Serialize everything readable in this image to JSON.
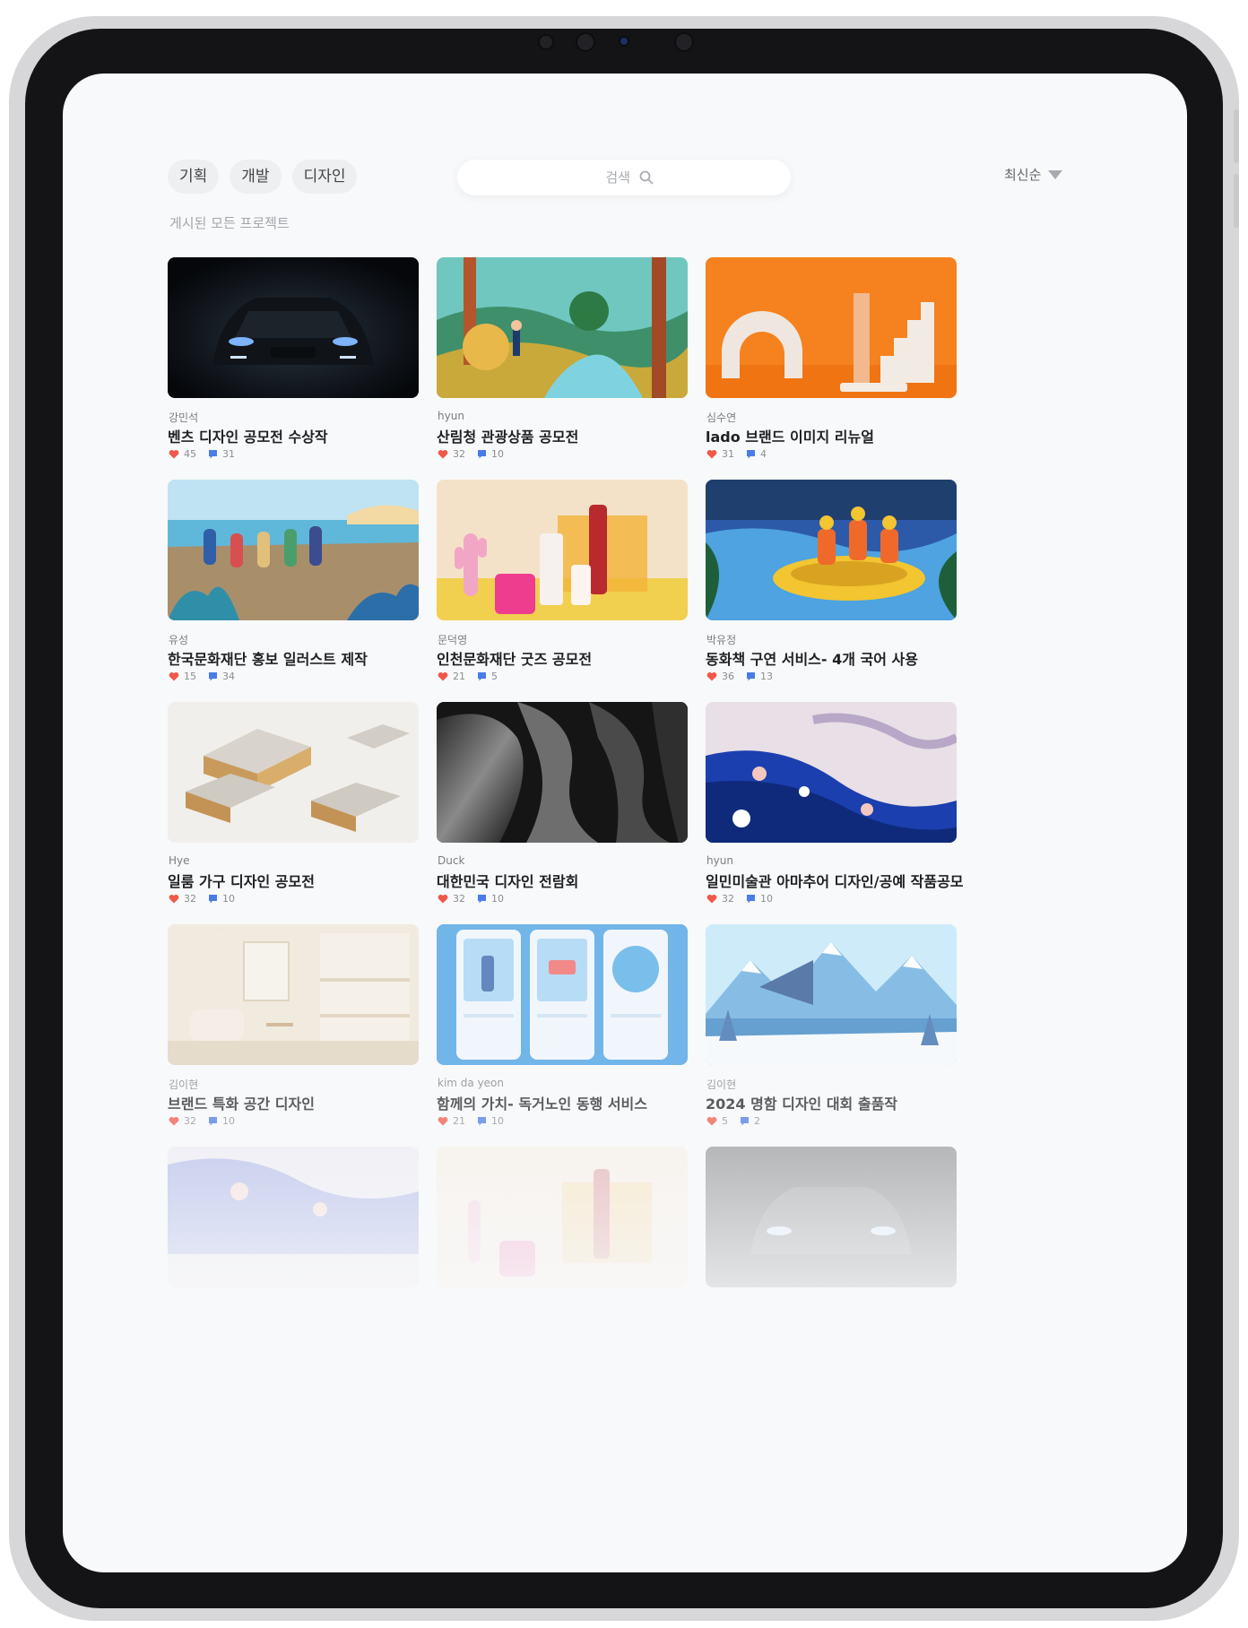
{
  "filters": [
    "기획",
    "개발",
    "디자인"
  ],
  "subtitle": "게시된 모든 프로젝트",
  "search": {
    "placeholder": "검색"
  },
  "sort": {
    "label": "최신순"
  },
  "projects": [
    {
      "author": "강민석",
      "title": "벤츠 디자인 공모전 수상작",
      "likes": "45",
      "comments": "31",
      "image": "dark car headlights"
    },
    {
      "author": "hyun",
      "title": "산림청 관광상품 공모전",
      "likes": "32",
      "comments": "10",
      "image": "forest illustration"
    },
    {
      "author": "심수연",
      "title": "lado 브랜드 이미지  리뉴얼",
      "likes": "31",
      "comments": "4",
      "image": "orange geometric shapes"
    },
    {
      "author": "유성",
      "title": "한국문화재단 홍보 일러스트 제작",
      "likes": "15",
      "comments": "34",
      "image": "beach people illustration"
    },
    {
      "author": "문덕영",
      "title": "인천문화재단 굿즈 공모전",
      "likes": "21",
      "comments": "5",
      "image": "pink cactus objects"
    },
    {
      "author": "박유정",
      "title": "동화책 구연 서비스- 4개 국어 사용",
      "likes": "36",
      "comments": "13",
      "image": "rafting illustration"
    },
    {
      "author": "Hye",
      "title": "일룸 가구 디자인 공모전",
      "likes": "32",
      "comments": "10",
      "image": "modular sofa"
    },
    {
      "author": "Duck",
      "title": "대한민국 디자인 전람회",
      "likes": "32",
      "comments": "10",
      "image": "black white fabric folds"
    },
    {
      "author": "hyun",
      "title": "일민미술관 아마추어 디자인/공예 작품공모",
      "likes": "32",
      "comments": "10",
      "image": "blue marble paint"
    },
    {
      "author": "김이현",
      "title": "브랜드 특화 공간 디자인",
      "likes": "32",
      "comments": "10",
      "image": "beige interior"
    },
    {
      "author": "kim da yeon",
      "title": "함께의 가치- 독거노인 동행 서비스",
      "likes": "21",
      "comments": "10",
      "image": "app onboarding screens"
    },
    {
      "author": "김이현",
      "title": "2024 명함 디자인 대회 출품작",
      "likes": "5",
      "comments": "2",
      "image": "snowy mountains"
    },
    {
      "image": "blue marble paint"
    },
    {
      "image": "pink cactus objects"
    },
    {
      "image": "dark car headlights"
    }
  ],
  "colors": {
    "heart": "#f0594a",
    "comment": "#4a7ce8",
    "background": "#f8f9fa"
  }
}
